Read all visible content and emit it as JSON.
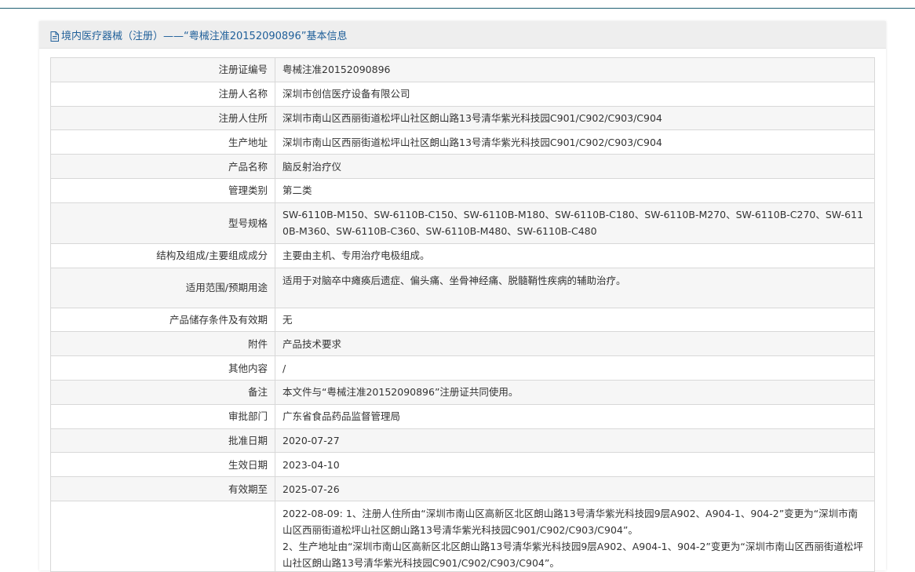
{
  "header": {
    "title": "境内医疗器械（注册）——“粤械注准20152090896”基本信息"
  },
  "rows": [
    {
      "label": "注册证编号",
      "value": "粤械注准20152090896"
    },
    {
      "label": "注册人名称",
      "value": "深圳市创信医疗设备有限公司"
    },
    {
      "label": "注册人住所",
      "value": "深圳市南山区西丽街道松坪山社区朗山路13号清华紫光科技园C901/C902/C903/C904"
    },
    {
      "label": "生产地址",
      "value": "深圳市南山区西丽街道松坪山社区朗山路13号清华紫光科技园C901/C902/C903/C904"
    },
    {
      "label": "产品名称",
      "value": "脑反射治疗仪"
    },
    {
      "label": "管理类别",
      "value": "第二类"
    },
    {
      "label": "型号规格",
      "value": "SW-6110B-M150、SW-6110B-C150、SW-6110B-M180、SW-6110B-C180、SW-6110B-M270、SW-6110B-C270、SW-6110B-M360、SW-6110B-C360、SW-6110B-M480、SW-6110B-C480"
    },
    {
      "label": "结构及组成/主要组成成分",
      "value": "主要由主机、专用治疗电极组成。"
    },
    {
      "label": "适用范围/预期用途",
      "value": "适用于对脑卒中瘫痪后遗症、偏头痛、坐骨神经痛、脱髓鞘性疾病的辅助治疗。"
    },
    {
      "label": "产品储存条件及有效期",
      "value": "无"
    },
    {
      "label": "附件",
      "value": "产品技术要求"
    },
    {
      "label": "其他内容",
      "value": "/"
    },
    {
      "label": "备注",
      "value": "本文件与“粤械注准20152090896”注册证共同使用。"
    },
    {
      "label": "审批部门",
      "value": "广东省食品药品监督管理局"
    },
    {
      "label": "批准日期",
      "value": "2020-07-27"
    },
    {
      "label": "生效日期",
      "value": "2023-04-10"
    },
    {
      "label": "有效期至",
      "value": "2025-07-26"
    }
  ],
  "changes": {
    "label": "",
    "lines": [
      "2022-08-09: 1、注册人住所由“深圳市南山区高新区北区朗山路13号清华紫光科技园9层A902、A904-1、904-2”变更为“深圳市南山区西丽街道松坪山社区朗山路13号清华紫光科技园C901/C902/C903/C904”。",
      "2、生产地址由“深圳市南山区高新区北区朗山路13号清华紫光科技园9层A902、A904-1、904-2”变更为“深圳市南山区西丽街道松坪山社区朗山路13号清华紫光科技园C901/C902/C903/C904”。"
    ]
  },
  "colors": {
    "title_blue": "#1f5f99",
    "header_bg": "#eeeeee",
    "row_alt_bg": "#f6f6f6",
    "border": "#d8d8d8"
  }
}
